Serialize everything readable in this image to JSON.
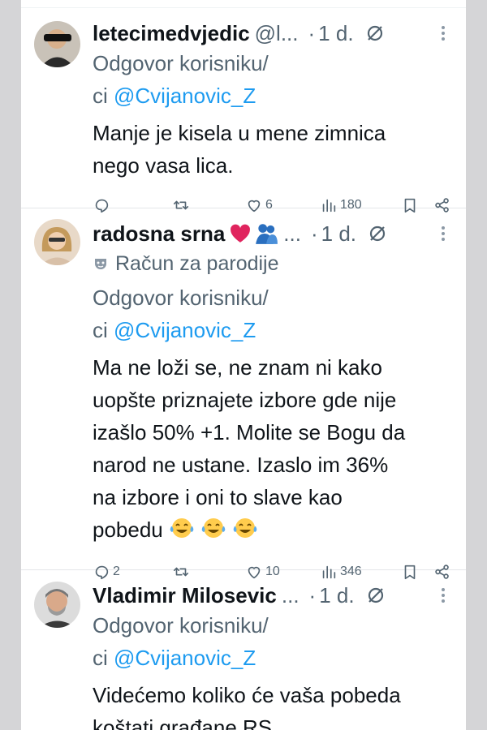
{
  "tweets": [
    {
      "display_name": "letecimedvjedic",
      "handle": "@l...",
      "time": "1 d.",
      "reply_label": "Odgovor korisniku/",
      "reply_prefix": "ci ",
      "reply_to": "@Cvijanovic_Z",
      "lines": [
        "Manje je kisela u mene zimnica",
        "nego vasa lica."
      ],
      "replies": "",
      "retweets": "",
      "likes": "6",
      "views": "180"
    },
    {
      "display_name": "radosna srna",
      "name_suffix": "...",
      "parody_label": "Račun za parodije",
      "time": "1 d.",
      "reply_label": "Odgovor korisniku/",
      "reply_prefix": "ci ",
      "reply_to": "@Cvijanovic_Z",
      "lines": [
        "Ma ne loži se, ne znam ni kako",
        "uopšte priznajete izbore gde nije",
        "izašlo 50% +1. Molite se Bogu da",
        "narod ne ustane. Izaslo im 36%",
        "na izbore i oni to slave kao",
        "pobedu"
      ],
      "replies": "2",
      "retweets": "",
      "likes": "10",
      "views": "346"
    },
    {
      "display_name": "Vladimir Milosevic",
      "name_suffix": "...",
      "time": "1 d.",
      "reply_label": "Odgovor korisniku/",
      "reply_prefix": "ci ",
      "reply_to": "@Cvijanovic_Z",
      "lines": [
        "Videćemo koliko će vaša pobeda",
        "koštati građane RS ."
      ]
    }
  ],
  "icons": {
    "reply": "reply-icon",
    "retweet": "retweet-icon",
    "like": "like-icon",
    "views": "views-icon",
    "bookmark": "bookmark-icon",
    "share": "share-icon",
    "grok": "grok-icon",
    "more": "more-icon",
    "parody": "parody-mask-icon"
  },
  "colors": {
    "link": "#1d9bf0",
    "secondary_text": "#536471",
    "primary_text": "#0f1419",
    "side_margin": "#d5d5d7"
  }
}
